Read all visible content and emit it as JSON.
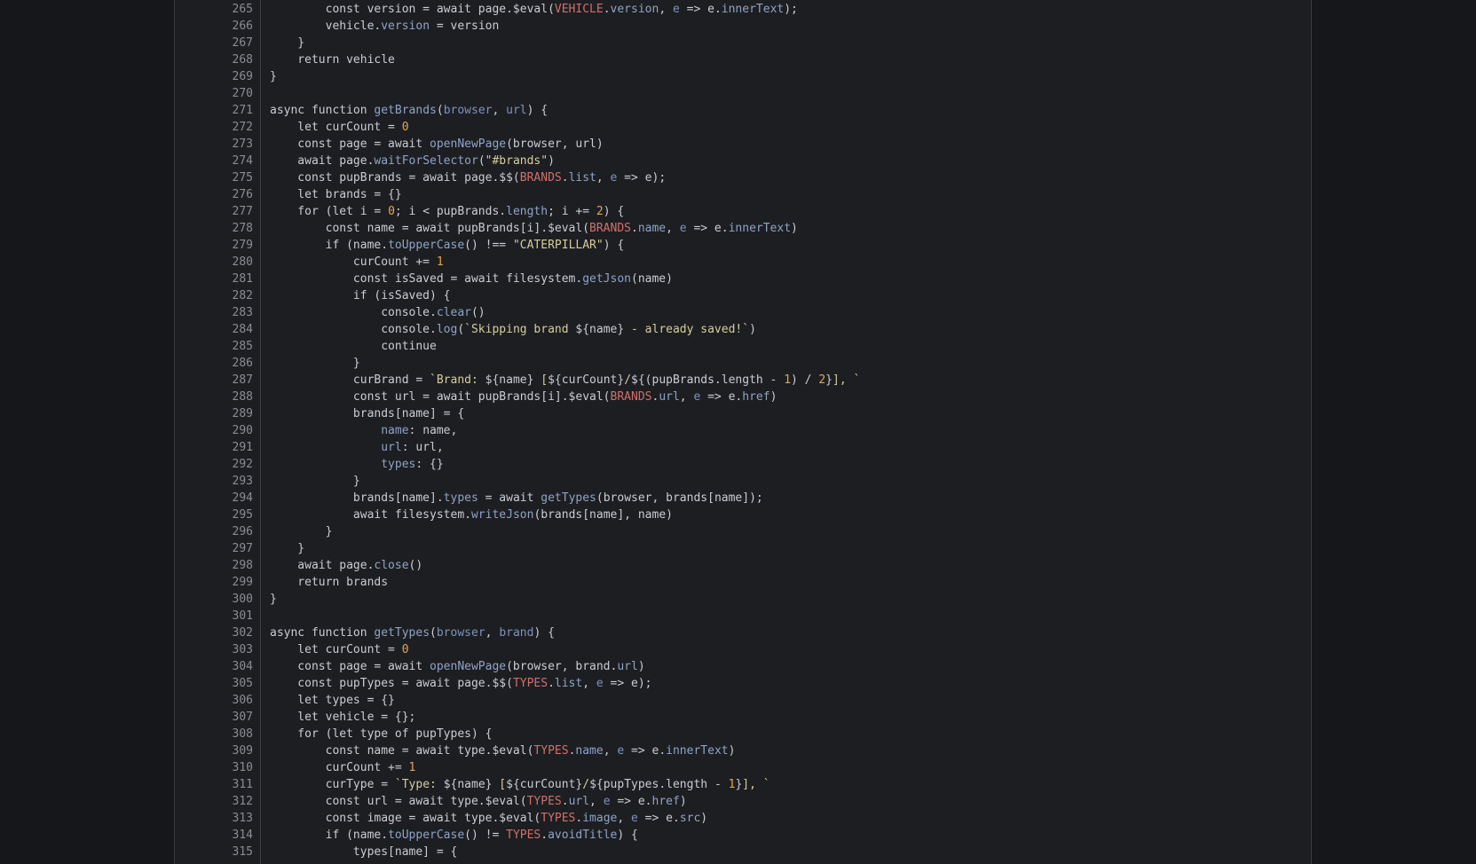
{
  "colors": {
    "background": "#16171b",
    "editor_bg": "#1d1e22",
    "line_number": "#8a8d93",
    "plain": "#c9ccd2",
    "function": "#8fa3c6",
    "property": "#8fa3c6",
    "parameter": "#7f92ba",
    "constant": "#d0706a",
    "number": "#e4a650",
    "string": "#d6cd9b"
  },
  "editor": {
    "lines": [
      {
        "n": "265",
        "tokens": [
          [
            "plain",
            "        const version = await page.$eval("
          ],
          [
            "const",
            "VEHICLE"
          ],
          [
            "plain",
            "."
          ],
          [
            "prop",
            "version"
          ],
          [
            "plain",
            ", "
          ],
          [
            "param",
            "e"
          ],
          [
            "plain",
            " => e."
          ],
          [
            "prop",
            "innerText"
          ],
          [
            "plain",
            ");"
          ]
        ]
      },
      {
        "n": "266",
        "tokens": [
          [
            "plain",
            "        vehicle."
          ],
          [
            "prop",
            "version"
          ],
          [
            "plain",
            " = version"
          ]
        ]
      },
      {
        "n": "267",
        "tokens": [
          [
            "plain",
            "    }"
          ]
        ]
      },
      {
        "n": "268",
        "tokens": [
          [
            "plain",
            "    return vehicle"
          ]
        ]
      },
      {
        "n": "269",
        "tokens": [
          [
            "plain",
            "}"
          ]
        ]
      },
      {
        "n": "270",
        "tokens": []
      },
      {
        "n": "271",
        "tokens": [
          [
            "plain",
            "async function "
          ],
          [
            "fn",
            "getBrands"
          ],
          [
            "plain",
            "("
          ],
          [
            "param",
            "browser"
          ],
          [
            "plain",
            ", "
          ],
          [
            "param",
            "url"
          ],
          [
            "plain",
            ") {"
          ]
        ]
      },
      {
        "n": "272",
        "tokens": [
          [
            "plain",
            "    let curCount = "
          ],
          [
            "num",
            "0"
          ]
        ]
      },
      {
        "n": "273",
        "tokens": [
          [
            "plain",
            "    const page = await "
          ],
          [
            "fn",
            "openNewPage"
          ],
          [
            "plain",
            "(browser, url)"
          ]
        ]
      },
      {
        "n": "274",
        "tokens": [
          [
            "plain",
            "    await page."
          ],
          [
            "fn",
            "waitForSelector"
          ],
          [
            "plain",
            "("
          ],
          [
            "str",
            "\"#brands\""
          ],
          [
            "plain",
            ")"
          ]
        ]
      },
      {
        "n": "275",
        "tokens": [
          [
            "plain",
            "    const pupBrands = await page.$$("
          ],
          [
            "const",
            "BRANDS"
          ],
          [
            "plain",
            "."
          ],
          [
            "prop",
            "list"
          ],
          [
            "plain",
            ", "
          ],
          [
            "param",
            "e"
          ],
          [
            "plain",
            " => e);"
          ]
        ]
      },
      {
        "n": "276",
        "tokens": [
          [
            "plain",
            "    let brands = {}"
          ]
        ]
      },
      {
        "n": "277",
        "tokens": [
          [
            "plain",
            "    for (let i = "
          ],
          [
            "num",
            "0"
          ],
          [
            "plain",
            "; i < pupBrands."
          ],
          [
            "prop",
            "length"
          ],
          [
            "plain",
            "; i += "
          ],
          [
            "num",
            "2"
          ],
          [
            "plain",
            ") {"
          ]
        ]
      },
      {
        "n": "278",
        "tokens": [
          [
            "plain",
            "        const name = await pupBrands[i].$eval("
          ],
          [
            "const",
            "BRANDS"
          ],
          [
            "plain",
            "."
          ],
          [
            "prop",
            "name"
          ],
          [
            "plain",
            ", "
          ],
          [
            "param",
            "e"
          ],
          [
            "plain",
            " => e."
          ],
          [
            "prop",
            "innerText"
          ],
          [
            "plain",
            ")"
          ]
        ]
      },
      {
        "n": "279",
        "tokens": [
          [
            "plain",
            "        if (name."
          ],
          [
            "fn",
            "toUpperCase"
          ],
          [
            "plain",
            "() !== "
          ],
          [
            "str",
            "\"CATERPILLAR\""
          ],
          [
            "plain",
            ") {"
          ]
        ]
      },
      {
        "n": "280",
        "tokens": [
          [
            "plain",
            "            curCount += "
          ],
          [
            "num",
            "1"
          ]
        ]
      },
      {
        "n": "281",
        "tokens": [
          [
            "plain",
            "            const isSaved = await filesystem."
          ],
          [
            "fn",
            "getJson"
          ],
          [
            "plain",
            "(name)"
          ]
        ]
      },
      {
        "n": "282",
        "tokens": [
          [
            "plain",
            "            if (isSaved) {"
          ]
        ]
      },
      {
        "n": "283",
        "tokens": [
          [
            "plain",
            "                console."
          ],
          [
            "fn",
            "clear"
          ],
          [
            "plain",
            "()"
          ]
        ]
      },
      {
        "n": "284",
        "tokens": [
          [
            "plain",
            "                console."
          ],
          [
            "fn",
            "log"
          ],
          [
            "plain",
            "("
          ],
          [
            "str",
            "`Skipping brand "
          ],
          [
            "plain",
            "${name}"
          ],
          [
            "str",
            " - already saved!`"
          ],
          [
            "plain",
            ")"
          ]
        ]
      },
      {
        "n": "285",
        "tokens": [
          [
            "plain",
            "                continue"
          ]
        ]
      },
      {
        "n": "286",
        "tokens": [
          [
            "plain",
            "            }"
          ]
        ]
      },
      {
        "n": "287",
        "tokens": [
          [
            "plain",
            "            curBrand = "
          ],
          [
            "str",
            "`Brand: "
          ],
          [
            "plain",
            "${name}"
          ],
          [
            "str",
            " ["
          ],
          [
            "plain",
            "${curCount}"
          ],
          [
            "str",
            "/"
          ],
          [
            "plain",
            "${(pupBrands.length - "
          ],
          [
            "num",
            "1"
          ],
          [
            "plain",
            ") / "
          ],
          [
            "num",
            "2"
          ],
          [
            "plain",
            "}"
          ],
          [
            "str",
            "], `"
          ]
        ]
      },
      {
        "n": "288",
        "tokens": [
          [
            "plain",
            "            const url = await pupBrands[i].$eval("
          ],
          [
            "const",
            "BRANDS"
          ],
          [
            "plain",
            "."
          ],
          [
            "prop",
            "url"
          ],
          [
            "plain",
            ", "
          ],
          [
            "param",
            "e"
          ],
          [
            "plain",
            " => e."
          ],
          [
            "prop",
            "href"
          ],
          [
            "plain",
            ")"
          ]
        ]
      },
      {
        "n": "289",
        "tokens": [
          [
            "plain",
            "            brands[name] = {"
          ]
        ]
      },
      {
        "n": "290",
        "tokens": [
          [
            "plain",
            "                "
          ],
          [
            "prop",
            "name"
          ],
          [
            "plain",
            ": name,"
          ]
        ]
      },
      {
        "n": "291",
        "tokens": [
          [
            "plain",
            "                "
          ],
          [
            "prop",
            "url"
          ],
          [
            "plain",
            ": url,"
          ]
        ]
      },
      {
        "n": "292",
        "tokens": [
          [
            "plain",
            "                "
          ],
          [
            "prop",
            "types"
          ],
          [
            "plain",
            ": {}"
          ]
        ]
      },
      {
        "n": "293",
        "tokens": [
          [
            "plain",
            "            }"
          ]
        ]
      },
      {
        "n": "294",
        "tokens": [
          [
            "plain",
            "            brands[name]."
          ],
          [
            "prop",
            "types"
          ],
          [
            "plain",
            " = await "
          ],
          [
            "fn",
            "getTypes"
          ],
          [
            "plain",
            "(browser, brands[name]);"
          ]
        ]
      },
      {
        "n": "295",
        "tokens": [
          [
            "plain",
            "            await filesystem."
          ],
          [
            "fn",
            "writeJson"
          ],
          [
            "plain",
            "(brands[name], name)"
          ]
        ]
      },
      {
        "n": "296",
        "tokens": [
          [
            "plain",
            "        }"
          ]
        ]
      },
      {
        "n": "297",
        "tokens": [
          [
            "plain",
            "    }"
          ]
        ]
      },
      {
        "n": "298",
        "tokens": [
          [
            "plain",
            "    await page."
          ],
          [
            "fn",
            "close"
          ],
          [
            "plain",
            "()"
          ]
        ]
      },
      {
        "n": "299",
        "tokens": [
          [
            "plain",
            "    return brands"
          ]
        ]
      },
      {
        "n": "300",
        "tokens": [
          [
            "plain",
            "}"
          ]
        ]
      },
      {
        "n": "301",
        "tokens": []
      },
      {
        "n": "302",
        "tokens": [
          [
            "plain",
            "async function "
          ],
          [
            "fn",
            "getTypes"
          ],
          [
            "plain",
            "("
          ],
          [
            "param",
            "browser"
          ],
          [
            "plain",
            ", "
          ],
          [
            "param",
            "brand"
          ],
          [
            "plain",
            ") {"
          ]
        ]
      },
      {
        "n": "303",
        "tokens": [
          [
            "plain",
            "    let curCount = "
          ],
          [
            "num",
            "0"
          ]
        ]
      },
      {
        "n": "304",
        "tokens": [
          [
            "plain",
            "    const page = await "
          ],
          [
            "fn",
            "openNewPage"
          ],
          [
            "plain",
            "(browser, brand."
          ],
          [
            "prop",
            "url"
          ],
          [
            "plain",
            ")"
          ]
        ]
      },
      {
        "n": "305",
        "tokens": [
          [
            "plain",
            "    const pupTypes = await page.$$("
          ],
          [
            "const",
            "TYPES"
          ],
          [
            "plain",
            "."
          ],
          [
            "prop",
            "list"
          ],
          [
            "plain",
            ", "
          ],
          [
            "param",
            "e"
          ],
          [
            "plain",
            " => e);"
          ]
        ]
      },
      {
        "n": "306",
        "tokens": [
          [
            "plain",
            "    let types = {}"
          ]
        ]
      },
      {
        "n": "307",
        "tokens": [
          [
            "plain",
            "    let vehicle = {};"
          ]
        ]
      },
      {
        "n": "308",
        "tokens": [
          [
            "plain",
            "    for (let type of pupTypes) {"
          ]
        ]
      },
      {
        "n": "309",
        "tokens": [
          [
            "plain",
            "        const name = await type.$eval("
          ],
          [
            "const",
            "TYPES"
          ],
          [
            "plain",
            "."
          ],
          [
            "prop",
            "name"
          ],
          [
            "plain",
            ", "
          ],
          [
            "param",
            "e"
          ],
          [
            "plain",
            " => e."
          ],
          [
            "prop",
            "innerText"
          ],
          [
            "plain",
            ")"
          ]
        ]
      },
      {
        "n": "310",
        "tokens": [
          [
            "plain",
            "        curCount += "
          ],
          [
            "num",
            "1"
          ]
        ]
      },
      {
        "n": "311",
        "tokens": [
          [
            "plain",
            "        curType = "
          ],
          [
            "str",
            "`Type: "
          ],
          [
            "plain",
            "${name}"
          ],
          [
            "str",
            " ["
          ],
          [
            "plain",
            "${curCount}"
          ],
          [
            "str",
            "/"
          ],
          [
            "plain",
            "${pupTypes.length - "
          ],
          [
            "num",
            "1"
          ],
          [
            "plain",
            "}"
          ],
          [
            "str",
            "], `"
          ]
        ]
      },
      {
        "n": "312",
        "tokens": [
          [
            "plain",
            "        const url = await type.$eval("
          ],
          [
            "const",
            "TYPES"
          ],
          [
            "plain",
            "."
          ],
          [
            "prop",
            "url"
          ],
          [
            "plain",
            ", "
          ],
          [
            "param",
            "e"
          ],
          [
            "plain",
            " => e."
          ],
          [
            "prop",
            "href"
          ],
          [
            "plain",
            ")"
          ]
        ]
      },
      {
        "n": "313",
        "tokens": [
          [
            "plain",
            "        const image = await type.$eval("
          ],
          [
            "const",
            "TYPES"
          ],
          [
            "plain",
            "."
          ],
          [
            "prop",
            "image"
          ],
          [
            "plain",
            ", "
          ],
          [
            "param",
            "e"
          ],
          [
            "plain",
            " => e."
          ],
          [
            "prop",
            "src"
          ],
          [
            "plain",
            ")"
          ]
        ]
      },
      {
        "n": "314",
        "tokens": [
          [
            "plain",
            "        if (name."
          ],
          [
            "fn",
            "toUpperCase"
          ],
          [
            "plain",
            "() != "
          ],
          [
            "const",
            "TYPES"
          ],
          [
            "plain",
            "."
          ],
          [
            "prop",
            "avoidTitle"
          ],
          [
            "plain",
            ") {"
          ]
        ]
      },
      {
        "n": "315",
        "tokens": [
          [
            "plain",
            "            types[name] = {"
          ]
        ]
      }
    ]
  }
}
